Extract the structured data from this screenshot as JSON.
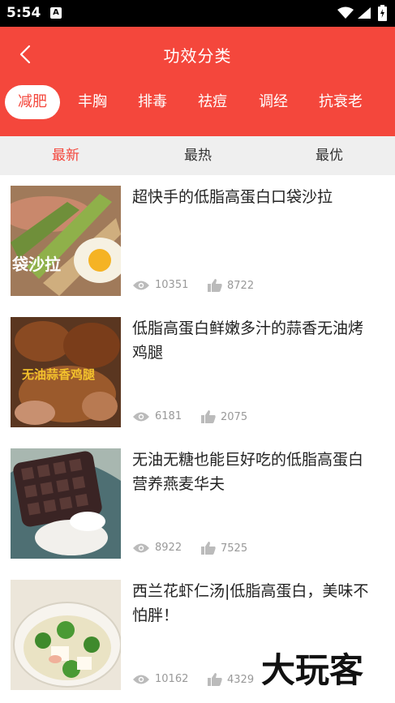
{
  "status_bar": {
    "time": "5:54",
    "notif": "A"
  },
  "header": {
    "title": "功效分类"
  },
  "categories": [
    {
      "label": "减肥",
      "active": true
    },
    {
      "label": "丰胸"
    },
    {
      "label": "排毒"
    },
    {
      "label": "祛痘"
    },
    {
      "label": "调经"
    },
    {
      "label": "抗衰老"
    }
  ],
  "sort_tabs": [
    {
      "label": "最新",
      "active": true
    },
    {
      "label": "最热"
    },
    {
      "label": "最优"
    }
  ],
  "recipes": [
    {
      "title": "超快手的低脂高蛋白口袋沙拉",
      "views": "10351",
      "likes": "8722",
      "thumb_text": "袋沙拉"
    },
    {
      "title": "低脂高蛋白鲜嫩多汁的蒜香无油烤鸡腿",
      "views": "6181",
      "likes": "2075",
      "thumb_text": "无油蒜香鸡腿"
    },
    {
      "title": "无油无糖也能巨好吃的低脂高蛋白营养燕麦华夫",
      "views": "8922",
      "likes": "7525"
    },
    {
      "title": "西兰花虾仁汤|低脂高蛋白，美味不怕胖！",
      "views": "10162",
      "likes": "4329"
    }
  ],
  "watermark": "大玩客",
  "colors": {
    "accent": "#f4473c",
    "sortbar_bg": "#efefef"
  }
}
